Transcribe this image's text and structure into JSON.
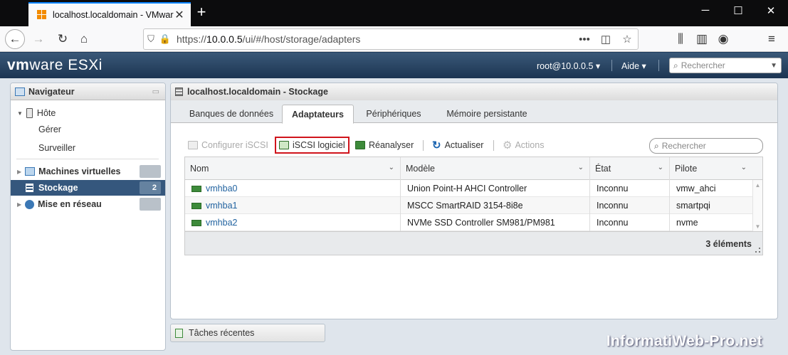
{
  "browser": {
    "tab_title": "localhost.localdomain - VMware",
    "url_prefix": "https://",
    "url_host": "10.0.0.5",
    "url_path": "/ui/#/host/storage/adapters"
  },
  "header": {
    "logo_vm": "vm",
    "logo_rest": "ware ESXi",
    "user": "root@10.0.0.5 ▾",
    "help": "Aide ▾",
    "search_placeholder": "Rechercher"
  },
  "navigator": {
    "title": "Navigateur",
    "host_label": "Hôte",
    "host_children": [
      "Gérer",
      "Surveiller"
    ],
    "items": [
      {
        "label": "Machines virtuelles",
        "count": ""
      },
      {
        "label": "Stockage",
        "count": "2"
      },
      {
        "label": "Mise en réseau",
        "count": ""
      }
    ]
  },
  "main": {
    "title": "localhost.localdomain - Stockage",
    "tabs": [
      "Banques de données",
      "Adaptateurs",
      "Périphériques",
      "Mémoire persistante"
    ],
    "active_tab": "Adaptateurs",
    "toolbar": {
      "configure_iscsi": "Configurer iSCSI",
      "software_iscsi": "iSCSI logiciel",
      "rescan": "Réanalyser",
      "refresh": "Actualiser",
      "actions": "Actions"
    },
    "search_placeholder": "Rechercher",
    "columns": [
      "Nom",
      "Modèle",
      "État",
      "Pilote"
    ],
    "rows": [
      {
        "name": "vmhba0",
        "model": "Union Point-H AHCI Controller",
        "state": "Inconnu",
        "driver": "vmw_ahci"
      },
      {
        "name": "vmhba1",
        "model": "MSCC SmartRAID 3154-8i8e",
        "state": "Inconnu",
        "driver": "smartpqi"
      },
      {
        "name": "vmhba2",
        "model": "NVMe SSD Controller SM981/PM981",
        "state": "Inconnu",
        "driver": "nvme"
      }
    ],
    "footer_count": "3 éléments"
  },
  "recent_tasks": "Tâches récentes",
  "watermark": "InformatiWeb-Pro.net",
  "colors": {
    "accent": "#35577d",
    "highlight": "#d0141c",
    "link": "#2263a0"
  }
}
